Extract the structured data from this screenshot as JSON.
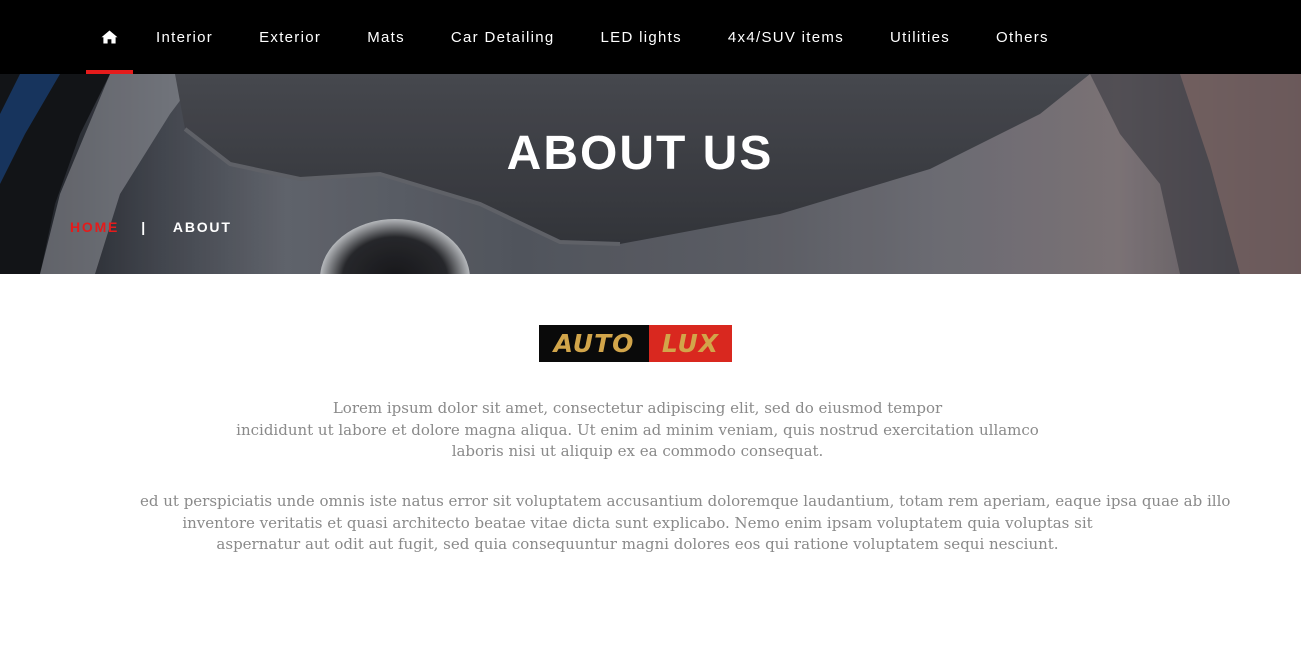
{
  "nav": {
    "home_icon": "home-icon",
    "items": [
      {
        "label": "Interior"
      },
      {
        "label": "Exterior"
      },
      {
        "label": "Mats"
      },
      {
        "label": "Car Detailing"
      },
      {
        "label": "LED lights"
      },
      {
        "label": "4x4/SUV items"
      },
      {
        "label": "Utilities"
      },
      {
        "label": "Others"
      }
    ],
    "active_color": "#e51b1b"
  },
  "hero": {
    "title_bold": "ABOUT",
    "title_light": "US",
    "breadcrumb": {
      "home": "HOME",
      "separator": "|",
      "current": "ABOUT"
    }
  },
  "logo": {
    "part1": "AUTO",
    "part2": "LUX"
  },
  "content": {
    "para1": [
      "Lorem ipsum dolor sit amet, consectetur adipiscing elit, sed do eiusmod tempor",
      "incididunt ut labore et dolore magna aliqua. Ut enim ad minim veniam, quis nostrud exercitation ullamco",
      "laboris nisi ut aliquip ex ea commodo consequat."
    ],
    "para2": [
      "ed ut perspiciatis unde omnis iste natus error sit voluptatem accusantium doloremque laudantium, totam rem aperiam, eaque ipsa quae ab illo",
      "inventore veritatis et quasi architecto beatae vitae dicta sunt explicabo. Nemo enim ipsam voluptatem quia voluptas sit",
      "aspernatur aut odit aut fugit, sed quia consequuntur magni dolores eos qui ratione voluptatem sequi nesciunt."
    ]
  }
}
